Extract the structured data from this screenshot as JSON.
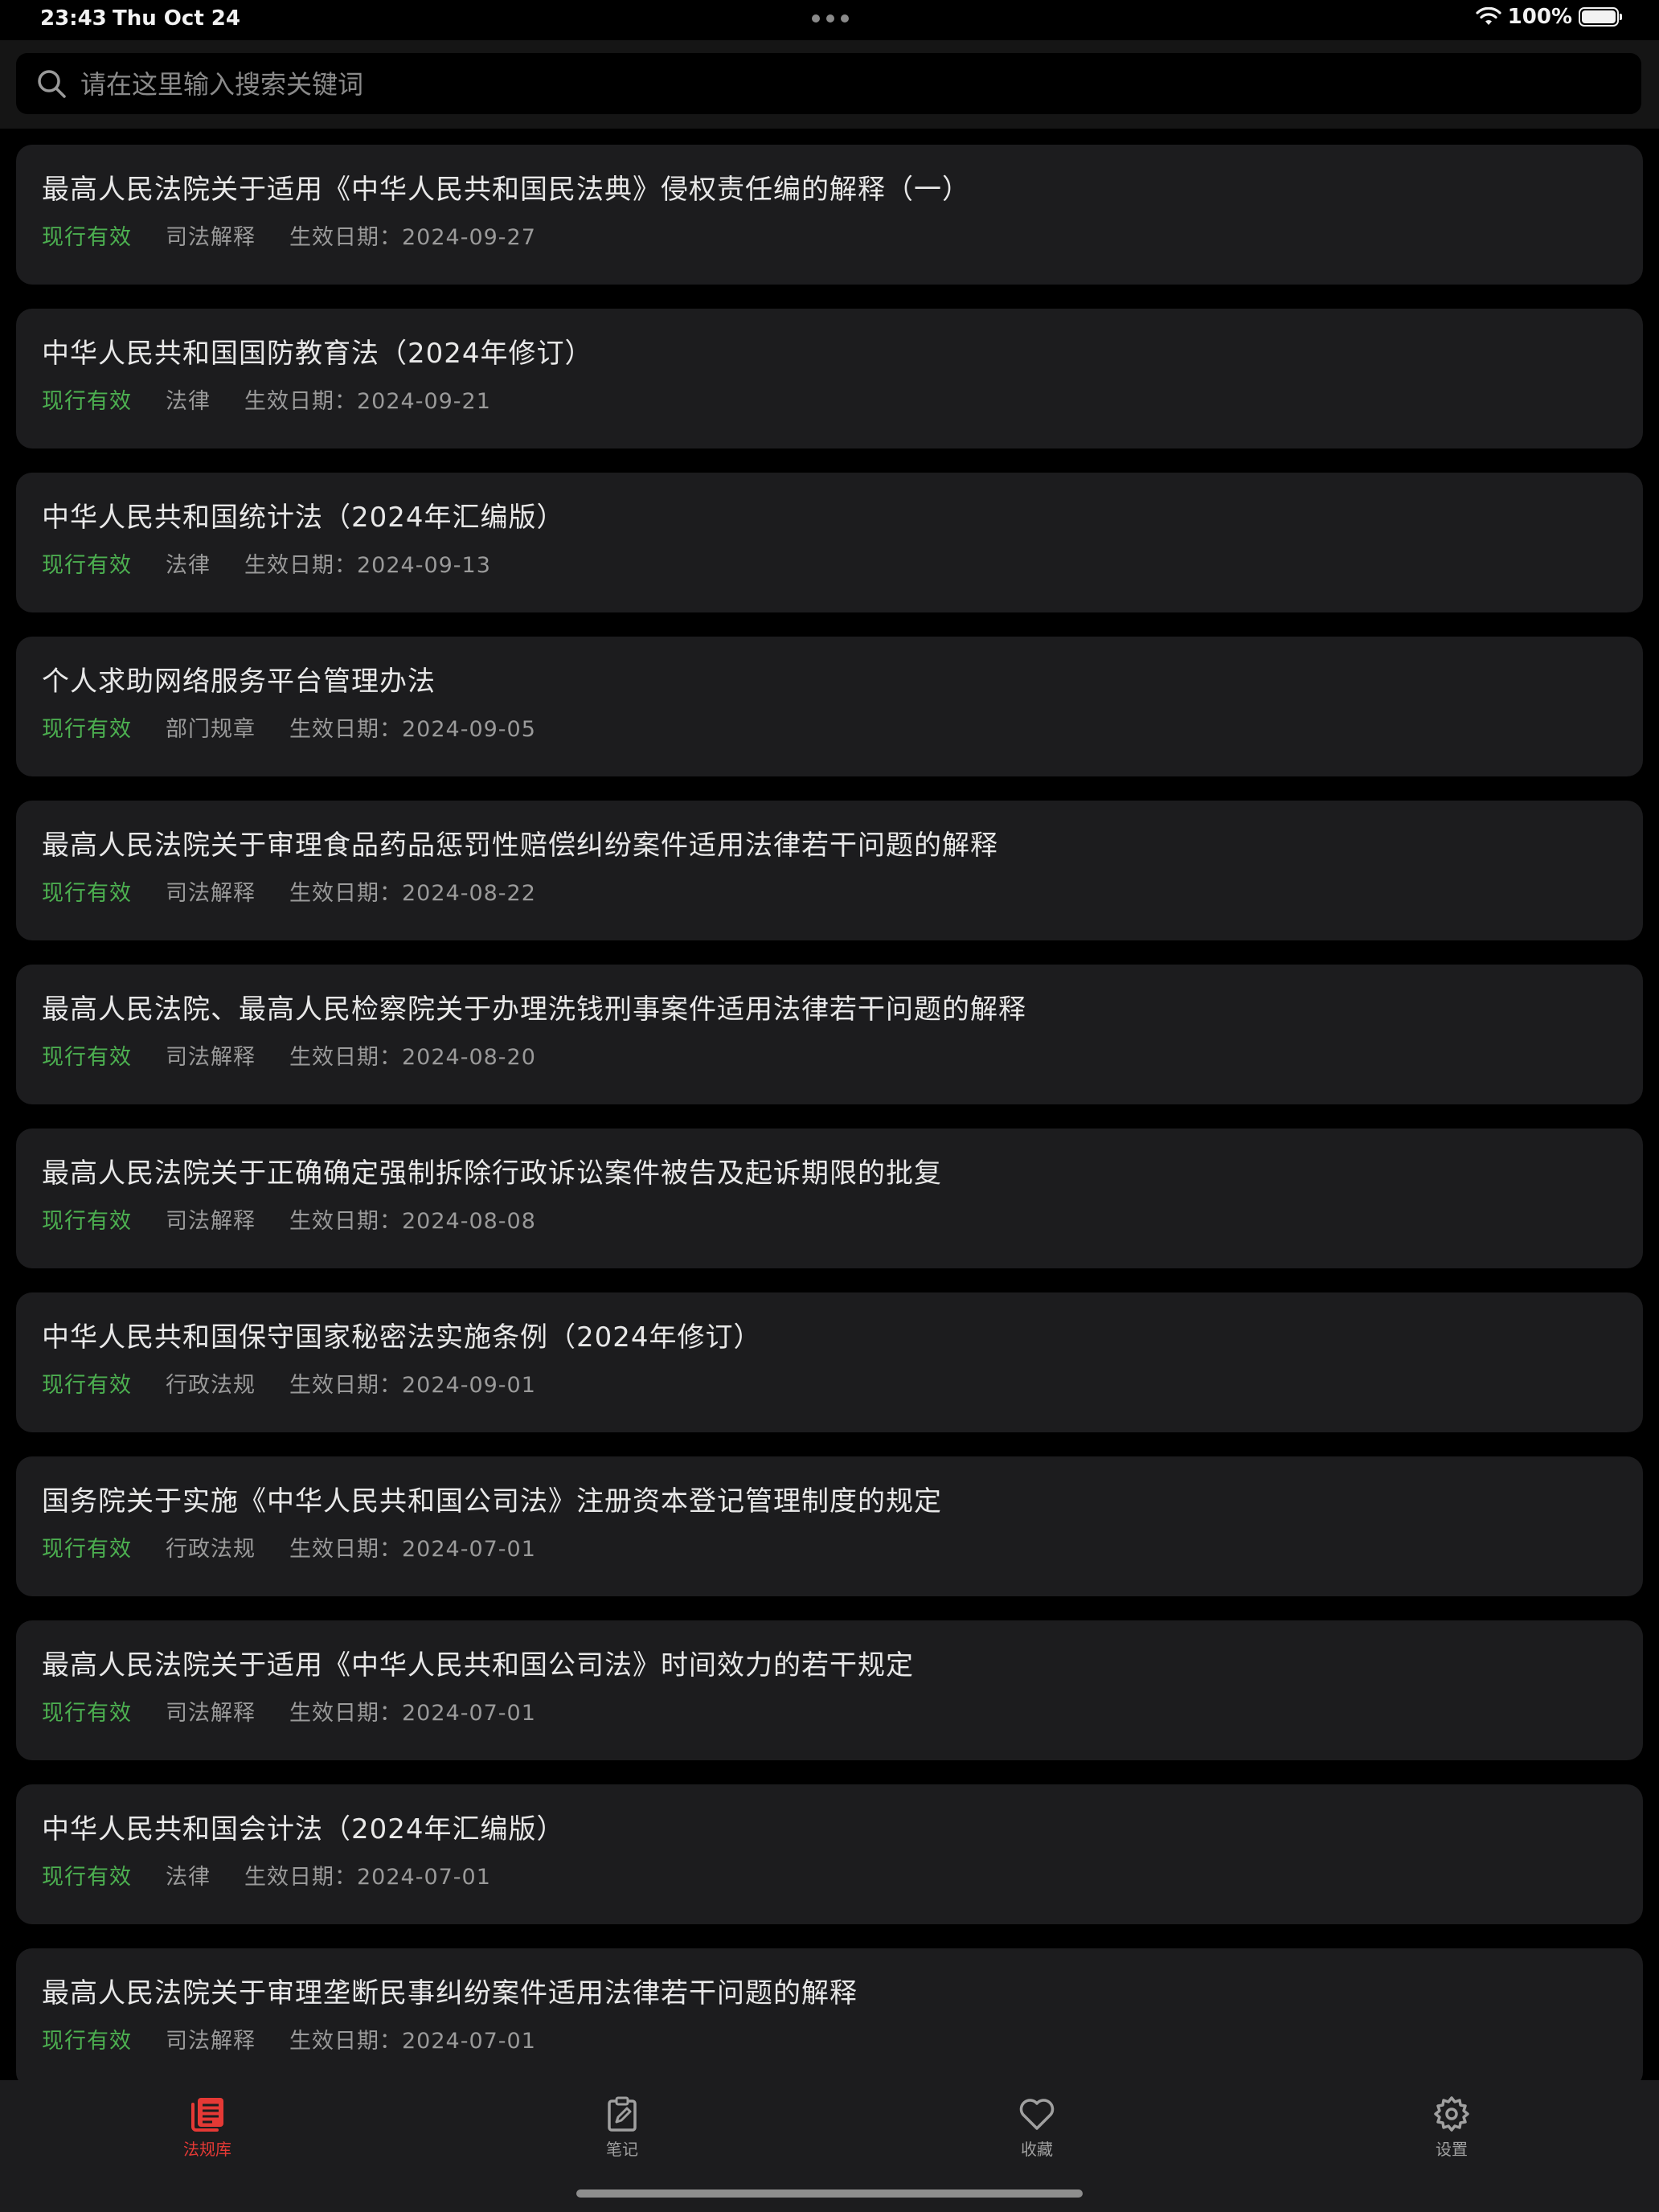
{
  "status_bar": {
    "time": "23:43",
    "date": "Thu Oct 24",
    "battery": "100%"
  },
  "search": {
    "placeholder": "请在这里输入搜索关键词",
    "value": ""
  },
  "laws": [
    {
      "title": "最高人民法院关于适用《中华人民共和国民法典》侵权责任编的解释（一）",
      "status": "现行有效",
      "type": "司法解释",
      "date": "生效日期：2024-09-27"
    },
    {
      "title": "中华人民共和国国防教育法（2024年修订）",
      "status": "现行有效",
      "type": "法律",
      "date": "生效日期：2024-09-21"
    },
    {
      "title": "中华人民共和国统计法（2024年汇编版）",
      "status": "现行有效",
      "type": "法律",
      "date": "生效日期：2024-09-13"
    },
    {
      "title": "个人求助网络服务平台管理办法",
      "status": "现行有效",
      "type": "部门规章",
      "date": "生效日期：2024-09-05"
    },
    {
      "title": "最高人民法院关于审理食品药品惩罚性赔偿纠纷案件适用法律若干问题的解释",
      "status": "现行有效",
      "type": "司法解释",
      "date": "生效日期：2024-08-22"
    },
    {
      "title": "最高人民法院、最高人民检察院关于办理洗钱刑事案件适用法律若干问题的解释",
      "status": "现行有效",
      "type": "司法解释",
      "date": "生效日期：2024-08-20"
    },
    {
      "title": "最高人民法院关于正确确定强制拆除行政诉讼案件被告及起诉期限的批复",
      "status": "现行有效",
      "type": "司法解释",
      "date": "生效日期：2024-08-08"
    },
    {
      "title": "中华人民共和国保守国家秘密法实施条例（2024年修订）",
      "status": "现行有效",
      "type": "行政法规",
      "date": "生效日期：2024-09-01"
    },
    {
      "title": "国务院关于实施《中华人民共和国公司法》注册资本登记管理制度的规定",
      "status": "现行有效",
      "type": "行政法规",
      "date": "生效日期：2024-07-01"
    },
    {
      "title": "最高人民法院关于适用《中华人民共和国公司法》时间效力的若干规定",
      "status": "现行有效",
      "type": "司法解释",
      "date": "生效日期：2024-07-01"
    },
    {
      "title": "中华人民共和国会计法（2024年汇编版）",
      "status": "现行有效",
      "type": "法律",
      "date": "生效日期：2024-07-01"
    },
    {
      "title": "最高人民法院关于审理垄断民事纠纷案件适用法律若干问题的解释",
      "status": "现行有效",
      "type": "司法解释",
      "date": "生效日期：2024-07-01"
    }
  ],
  "tabs": [
    {
      "label": "法规库",
      "icon": "law-library-icon",
      "active": true
    },
    {
      "label": "笔记",
      "icon": "notes-icon",
      "active": false
    },
    {
      "label": "收藏",
      "icon": "heart-icon",
      "active": false
    },
    {
      "label": "设置",
      "icon": "gear-icon",
      "active": false
    }
  ],
  "colors": {
    "background": "#000000",
    "card": "#1c1c1e",
    "status_valid": "#4caf50",
    "tab_active": "#e53935",
    "tab_inactive": "#a0a0a0"
  }
}
